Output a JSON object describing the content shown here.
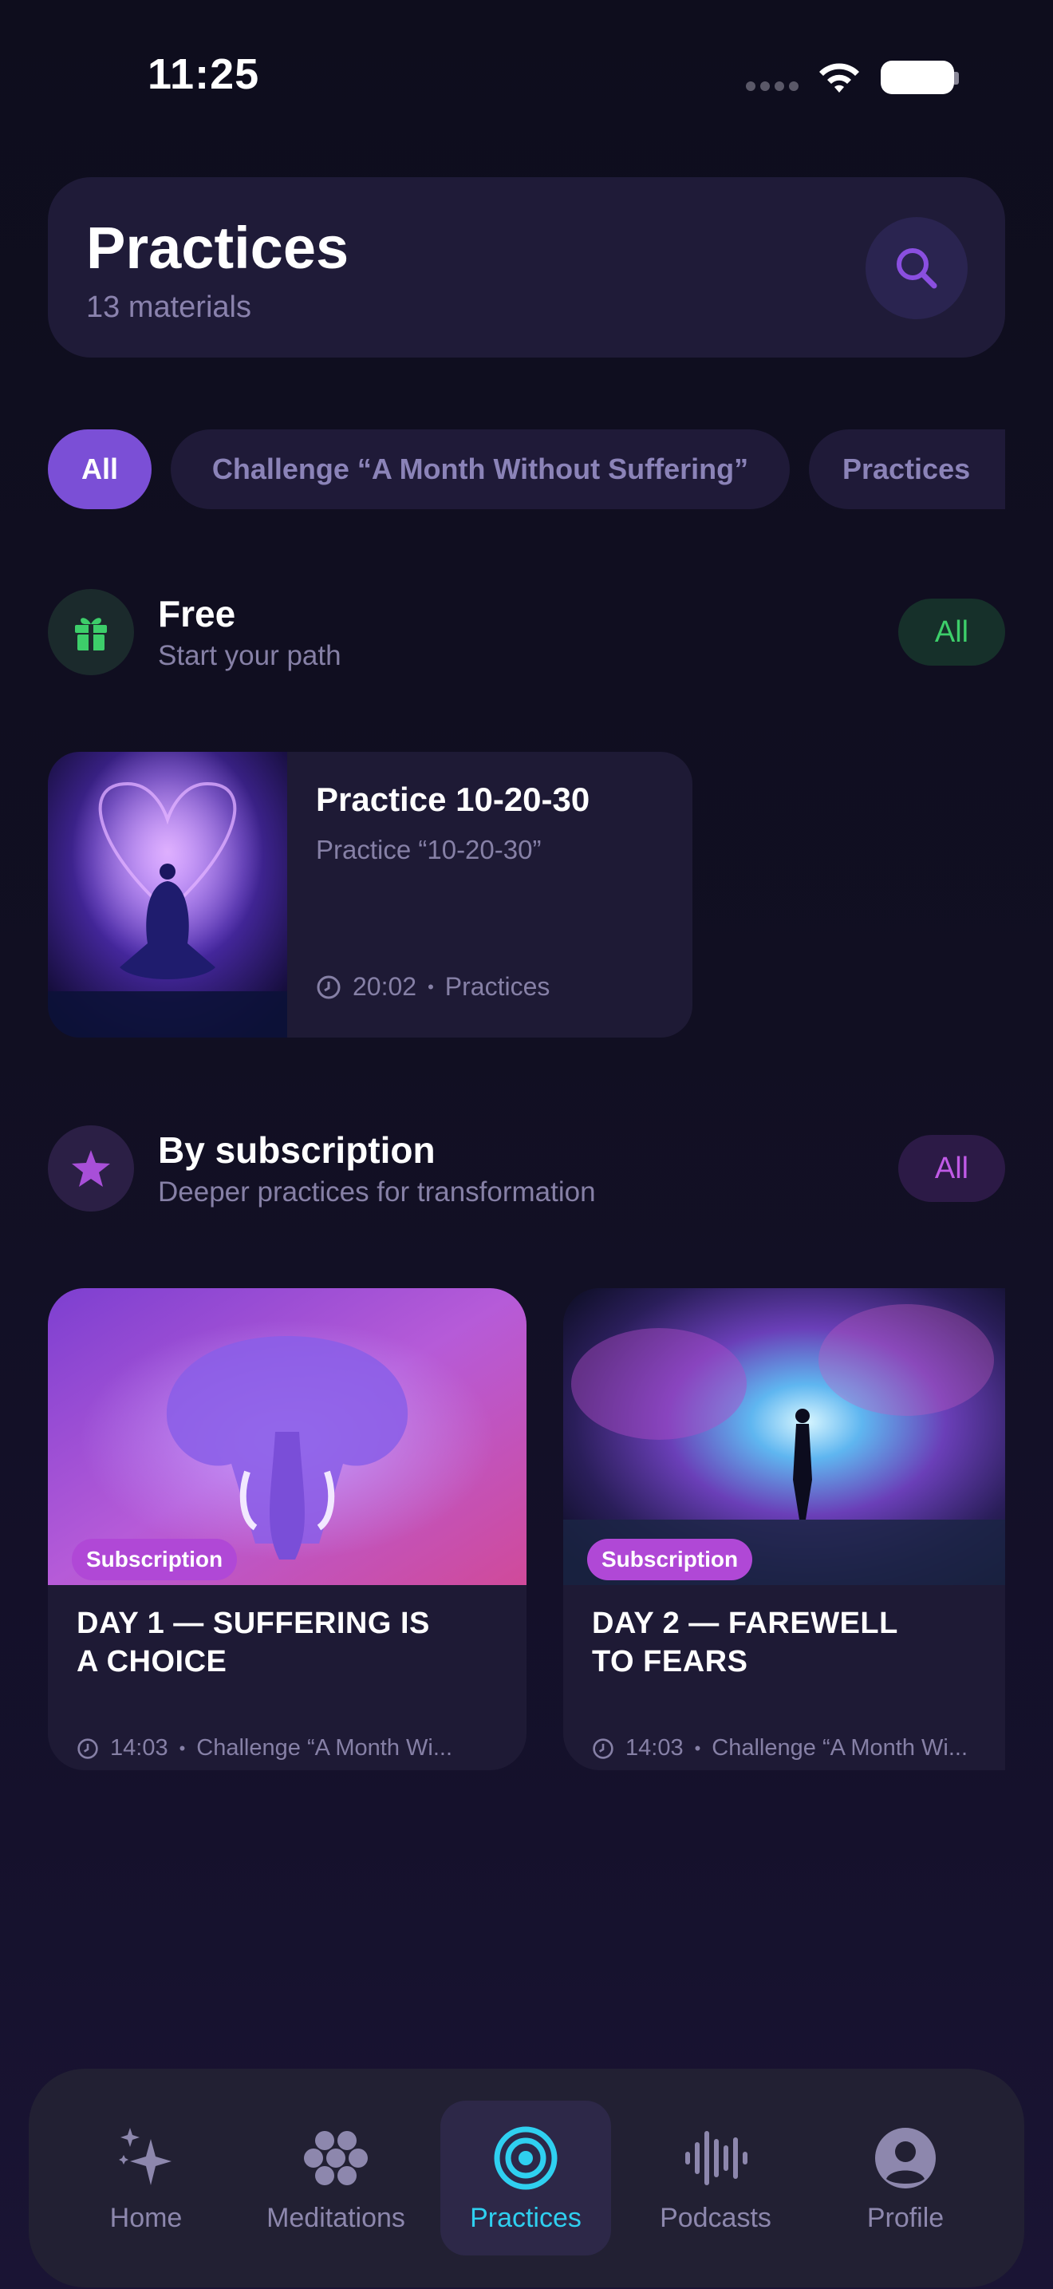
{
  "status_bar": {
    "time": "11:25"
  },
  "header": {
    "title": "Practices",
    "subtitle": "13 materials"
  },
  "filters": [
    "All",
    "Challenge “A Month Without Suffering”",
    "Practices"
  ],
  "free_section": {
    "title": "Free",
    "subtitle": "Start your path",
    "all_label": "All",
    "card": {
      "title": "Practice 10-20-30",
      "subtitle": "Practice “10-20-30”",
      "duration": "20:02",
      "category": "Practices"
    }
  },
  "subscription_section": {
    "title": "By subscription",
    "subtitle": "Deeper practices for transformation",
    "all_label": "All",
    "cards": [
      {
        "badge": "Subscription",
        "title_line1": "DAY 1 — SUFFERING IS",
        "title_line2": "A CHOICE",
        "duration": "14:03",
        "category": "Challenge “A Month Wi..."
      },
      {
        "badge": "Subscription",
        "title_line1": "DAY 2 — FAREWELL",
        "title_line2": "TO FEARS",
        "duration": "14:03",
        "category": "Challenge “A Month Wi..."
      }
    ]
  },
  "nav": {
    "items": [
      {
        "label": "Home",
        "icon": "sparkles-icon"
      },
      {
        "label": "Meditations",
        "icon": "flower-dots-icon"
      },
      {
        "label": "Practices",
        "icon": "target-icon"
      },
      {
        "label": "Podcasts",
        "icon": "waveform-icon"
      },
      {
        "label": "Profile",
        "icon": "person-circle-icon"
      }
    ],
    "active": "Practices"
  },
  "colors": {
    "accent": "#7b4fd6",
    "active_nav": "#2fd0f0",
    "free_green": "#3dce6a",
    "badge": "#b048d6"
  }
}
